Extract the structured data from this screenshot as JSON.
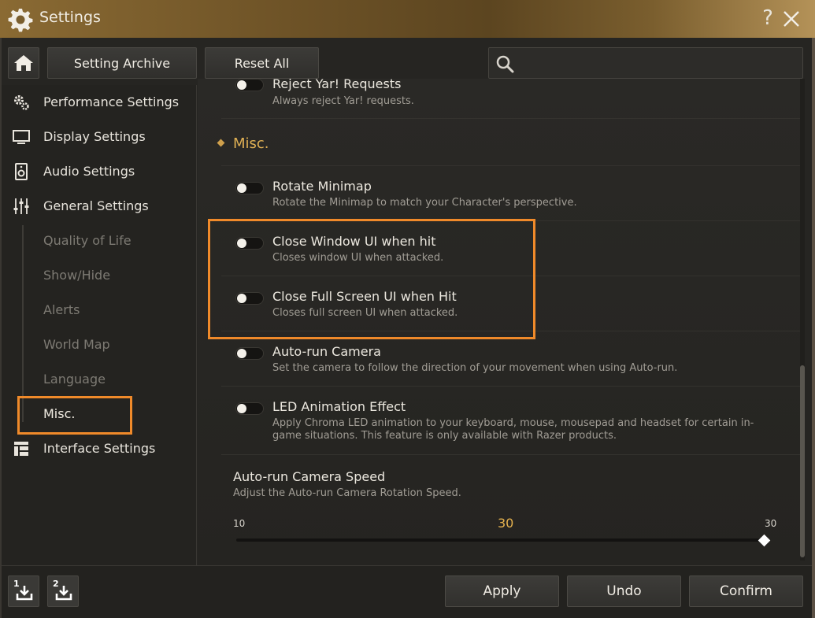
{
  "window": {
    "title": "Settings",
    "help_label": "?"
  },
  "toolbar": {
    "setting_archive_label": "Setting Archive",
    "reset_all_label": "Reset All",
    "search_placeholder": ""
  },
  "sidebar": {
    "items": [
      {
        "label": "Performance Settings",
        "icon": "gears-icon"
      },
      {
        "label": "Display Settings",
        "icon": "monitor-icon"
      },
      {
        "label": "Audio Settings",
        "icon": "speaker-icon"
      },
      {
        "label": "General Settings",
        "icon": "sliders-icon"
      },
      {
        "label": "Interface Settings",
        "icon": "layout-icon"
      }
    ],
    "general_sub": [
      "Quality of Life",
      "Show/Hide",
      "Alerts",
      "World Map",
      "Language",
      "Misc."
    ],
    "active_sub": "Misc."
  },
  "content": {
    "partial_row": {
      "title": "Reject Yar! Requests",
      "desc": "Always reject Yar! requests."
    },
    "section_title": "Misc.",
    "options": [
      {
        "title": "Rotate Minimap",
        "desc": "Rotate the Minimap to match your Character's perspective.",
        "enabled": false
      },
      {
        "title": "Close Window UI when hit",
        "desc": "Closes window UI when attacked.",
        "enabled": false
      },
      {
        "title": "Close Full Screen UI when Hit",
        "desc": "Closes full screen UI when attacked.",
        "enabled": false
      },
      {
        "title": "Auto-run Camera",
        "desc": "Set the camera to follow the direction of your movement when using Auto-run.",
        "enabled": false
      },
      {
        "title": "LED Animation Effect",
        "desc": "Apply Chroma LED animation to your keyboard, mouse, mousepad  and headset for certain in-game situations. This feature is only available with Razer products.",
        "enabled": false
      }
    ],
    "slider": {
      "title": "Auto-run Camera Speed",
      "desc": "Adjust the Auto-run Camera Rotation Speed.",
      "min": "10",
      "value": "30",
      "max": "30"
    }
  },
  "footer": {
    "preset_1": "1",
    "preset_2": "2",
    "apply_label": "Apply",
    "undo_label": "Undo",
    "confirm_label": "Confirm"
  },
  "colors": {
    "accent": "#f08a2a",
    "section": "#e0b054",
    "title_bar": "#7a5e2e"
  }
}
